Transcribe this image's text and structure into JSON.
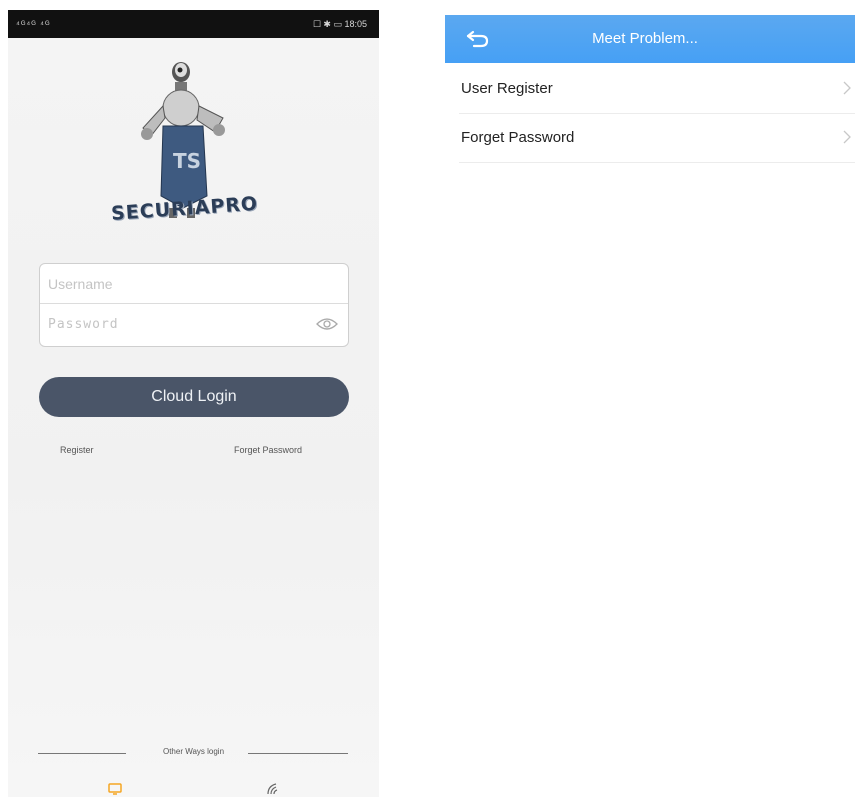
{
  "left_screen": {
    "status_bar": {
      "signal_text": "⁴ᴳ⁴ᴳ ⁴ᴳ",
      "right_text": "☐ ✱ ▭ 18:05"
    },
    "logo_text": "SECURIAPRO",
    "username_placeholder": "Username",
    "password_placeholder": "Password",
    "cloud_login_label": "Cloud Login",
    "register_link": "Register",
    "forget_password_link": "Forget Password",
    "other_ways_label": "Other Ways login",
    "icons": {
      "monitor": "monitor-icon",
      "wifi": "wifi-icon",
      "eye": "eye-icon"
    },
    "colors": {
      "button": "#4a5568",
      "monitor_icon": "#f5a623"
    }
  },
  "right_screen": {
    "nav_title": "Meet Problem...",
    "items": [
      {
        "label": "User Register"
      },
      {
        "label": "Forget Password"
      }
    ],
    "icons": {
      "back": "back-icon",
      "chevron": "chevron-right-icon"
    },
    "colors": {
      "nav": "#4aa2f4"
    }
  }
}
